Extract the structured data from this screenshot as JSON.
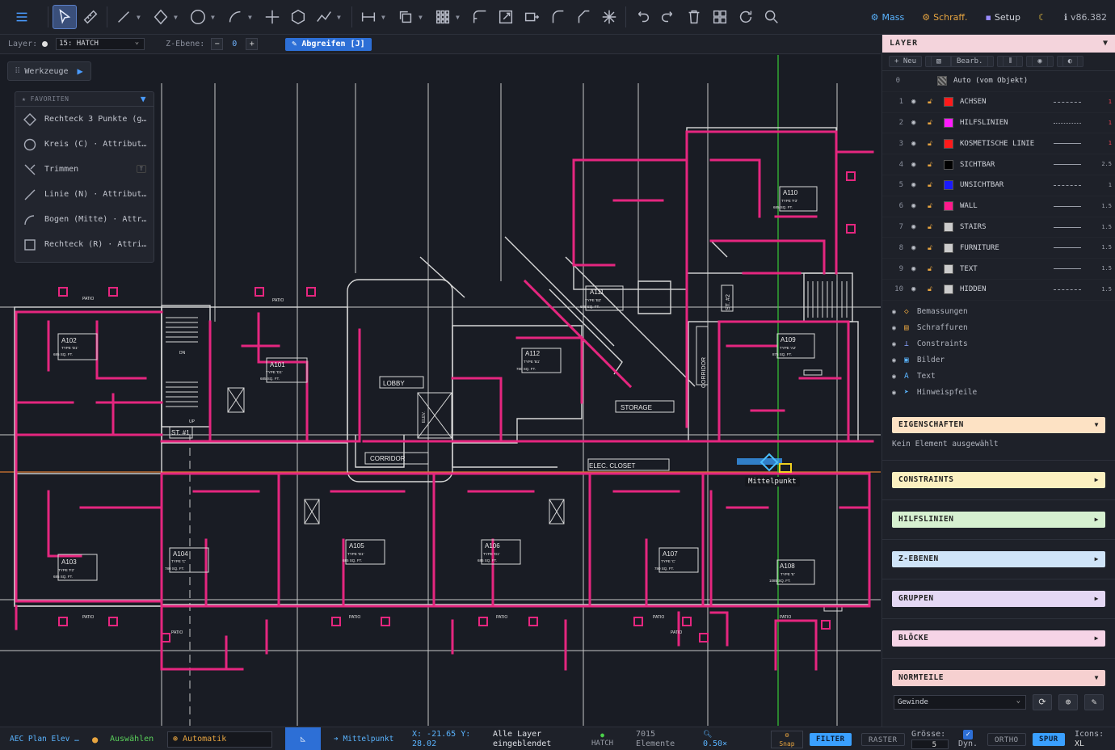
{
  "toolbar": {
    "right": {
      "mass_label": "Mass",
      "schraff_label": "Schraff.",
      "setup_label": "Setup",
      "version": "v86.382"
    }
  },
  "options": {
    "layer_label": "Layer:",
    "layer_value": "15: HATCH",
    "zebene_label": "Z-Ebene:",
    "zebene_minus": "−",
    "zebene_value": "0",
    "zebene_plus": "+",
    "grab_label": "Abgreifen [J]"
  },
  "tools": {
    "werkzeuge_label": "Werkzeuge",
    "favorites_title": "FAVORITEN",
    "favorites": [
      {
        "icon": "rectangle-3-points-icon",
        "label": "Rechteck 3 Punkte (g…"
      },
      {
        "icon": "circle-icon",
        "label": "Kreis (C) · Attribut…"
      },
      {
        "icon": "trim-icon",
        "label": "Trimmen",
        "key": "T"
      },
      {
        "icon": "line-icon",
        "label": "Linie (N) · Attribut…"
      },
      {
        "icon": "arc-icon",
        "label": "Bogen (Mitte) · Attr…"
      },
      {
        "icon": "rectangle-icon",
        "label": "Rechteck (R) · Attri…"
      }
    ]
  },
  "canvas": {
    "snap_tooltip": "Mittelpunkt",
    "rooms": [
      {
        "id": "A102",
        "type": "TYPE 'D1'",
        "area": "685 SQ. FT."
      },
      {
        "id": "A101",
        "type": "TYPE 'D1'",
        "area": "685 SQ. FT."
      },
      {
        "id": "A103",
        "type": "TYPE 'F2'",
        "area": "685 SQ. FT."
      },
      {
        "id": "A104",
        "type": "TYPE 'C'",
        "area": "780 SQ. FT."
      },
      {
        "id": "A105",
        "type": "TYPE 'D1'",
        "area": "685 SQ. FT."
      },
      {
        "id": "A106",
        "type": "TYPE 'D1'",
        "area": "685 SQ. FT."
      },
      {
        "id": "A107",
        "type": "TYPE 'C'",
        "area": "780 SQ. FT."
      },
      {
        "id": "A108",
        "type": "TYPE 'E'",
        "area": "1085 SQ. FT."
      },
      {
        "id": "A109",
        "type": "TYPE 'A2'",
        "area": "875 SQ. FT."
      },
      {
        "id": "A110",
        "type": "TYPE 'F3'",
        "area": "685 SQ. FT."
      },
      {
        "id": "A111",
        "type": "TYPE 'B2'",
        "area": "685 SQ. FT."
      },
      {
        "id": "A112",
        "type": "TYPE 'B1'",
        "area": "780 SQ. FT."
      }
    ],
    "labels": {
      "lobby": "LOBBY",
      "corridor": "CORRIDOR",
      "corridor_v": "CORRIDOR",
      "storage": "STORAGE",
      "elec_closet": "ELEC. CLOSET",
      "st1": "ST. #1",
      "st2": "ST. #2",
      "patio": "PATIO",
      "dn": "DN",
      "up": "UP",
      "elev": "ELEV."
    }
  },
  "panel": {
    "layer_title": "LAYER",
    "tool_new": "+ Neu",
    "tool_edit": "Bearb.",
    "auto_label": "Auto (vom Objekt)",
    "auto_num": "0",
    "layers": [
      {
        "num": "1",
        "name": "ACHSEN",
        "color": "#ff1a1a",
        "style": "dash",
        "lw": "1",
        "lw_red": true
      },
      {
        "num": "2",
        "name": "HILFSLINIEN",
        "color": "#ff1aff",
        "style": "dot",
        "lw": "1",
        "lw_red": true
      },
      {
        "num": "3",
        "name": "KOSMETISCHE LINIE",
        "color": "#ff1a1a",
        "style": "solid",
        "lw": "1",
        "lw_red": true
      },
      {
        "num": "4",
        "name": "SICHTBAR",
        "color": "#000000",
        "style": "solid",
        "lw": "2.5",
        "lw_red": false
      },
      {
        "num": "5",
        "name": "UNSICHTBAR",
        "color": "#1a1aff",
        "style": "dash",
        "lw": "1",
        "lw_red": false
      },
      {
        "num": "6",
        "name": "WALL",
        "color": "#ff1a8c",
        "style": "solid",
        "lw": "1.5",
        "lw_red": false
      },
      {
        "num": "7",
        "name": "STAIRS",
        "color": "#cccccc",
        "style": "solid",
        "lw": "1.5",
        "lw_red": false
      },
      {
        "num": "8",
        "name": "FURNITURE",
        "color": "#cccccc",
        "style": "solid",
        "lw": "1.5",
        "lw_red": false
      },
      {
        "num": "9",
        "name": "TEXT",
        "color": "#cccccc",
        "style": "solid",
        "lw": "1.5",
        "lw_red": false
      },
      {
        "num": "10",
        "name": "HIDDEN",
        "color": "#cccccc",
        "style": "dash",
        "lw": "1.5",
        "lw_red": false
      }
    ],
    "sublayers": [
      {
        "icon": "dimension-icon",
        "glyph": "◇",
        "color": "#e8a540",
        "label": "Bemassungen"
      },
      {
        "icon": "hatch-icon",
        "glyph": "▤",
        "color": "#e8a540",
        "label": "Schraffuren"
      },
      {
        "icon": "constraint-icon",
        "glyph": "⊥",
        "color": "#8aa4ff",
        "label": "Constraints"
      },
      {
        "icon": "image-icon",
        "glyph": "▣",
        "color": "#5ab4ff",
        "label": "Bilder"
      },
      {
        "icon": "text-icon",
        "glyph": "A",
        "color": "#5ab4ff",
        "label": "Text"
      },
      {
        "icon": "leader-icon",
        "glyph": "➤",
        "color": "#5ab4ff",
        "label": "Hinweispfeile"
      }
    ],
    "eigenschaften_title": "EIGENSCHAFTEN",
    "eigenschaften_sub": "Kein Element ausgewählt",
    "constraints_title": "CONSTRAINTS",
    "hilfslinien_title": "HILFSLINIEN",
    "zebenen_title": "Z-EBENEN",
    "gruppen_title": "GRUPPEN",
    "bloecke_title": "BLÖCKE",
    "normteile_title": "NORMTEILE",
    "normteile_select": "Gewinde"
  },
  "status": {
    "file": "AEC Plan Elev …",
    "mode": "Auswählen",
    "auto": "Automatik",
    "snap_hint": "➔ Mittelpunkt",
    "coords_x": "X: -21.65",
    "coords_y": "Y:",
    "coords_y2": "28.02",
    "layers_vis_1": "Alle Layer",
    "layers_vis_2": "eingeblendet",
    "cur_layer": "HATCH",
    "elements_count": "7015",
    "elements_label": "Elemente",
    "zoom": "0.50×",
    "snap_label": "Snap",
    "filter": "FILTER",
    "raster": "RASTER",
    "groesse": "Grösse:",
    "groesse_val": "5",
    "dyn": "Dyn.",
    "ortho": "ORTHO",
    "spur": "SPUR",
    "icons_label": "Icons:",
    "icons_val": "XL"
  },
  "colors": {
    "wall": "#e5267f",
    "line": "#d8d8d8",
    "accent": "#2d6fd6",
    "guide_green": "#37c837"
  }
}
